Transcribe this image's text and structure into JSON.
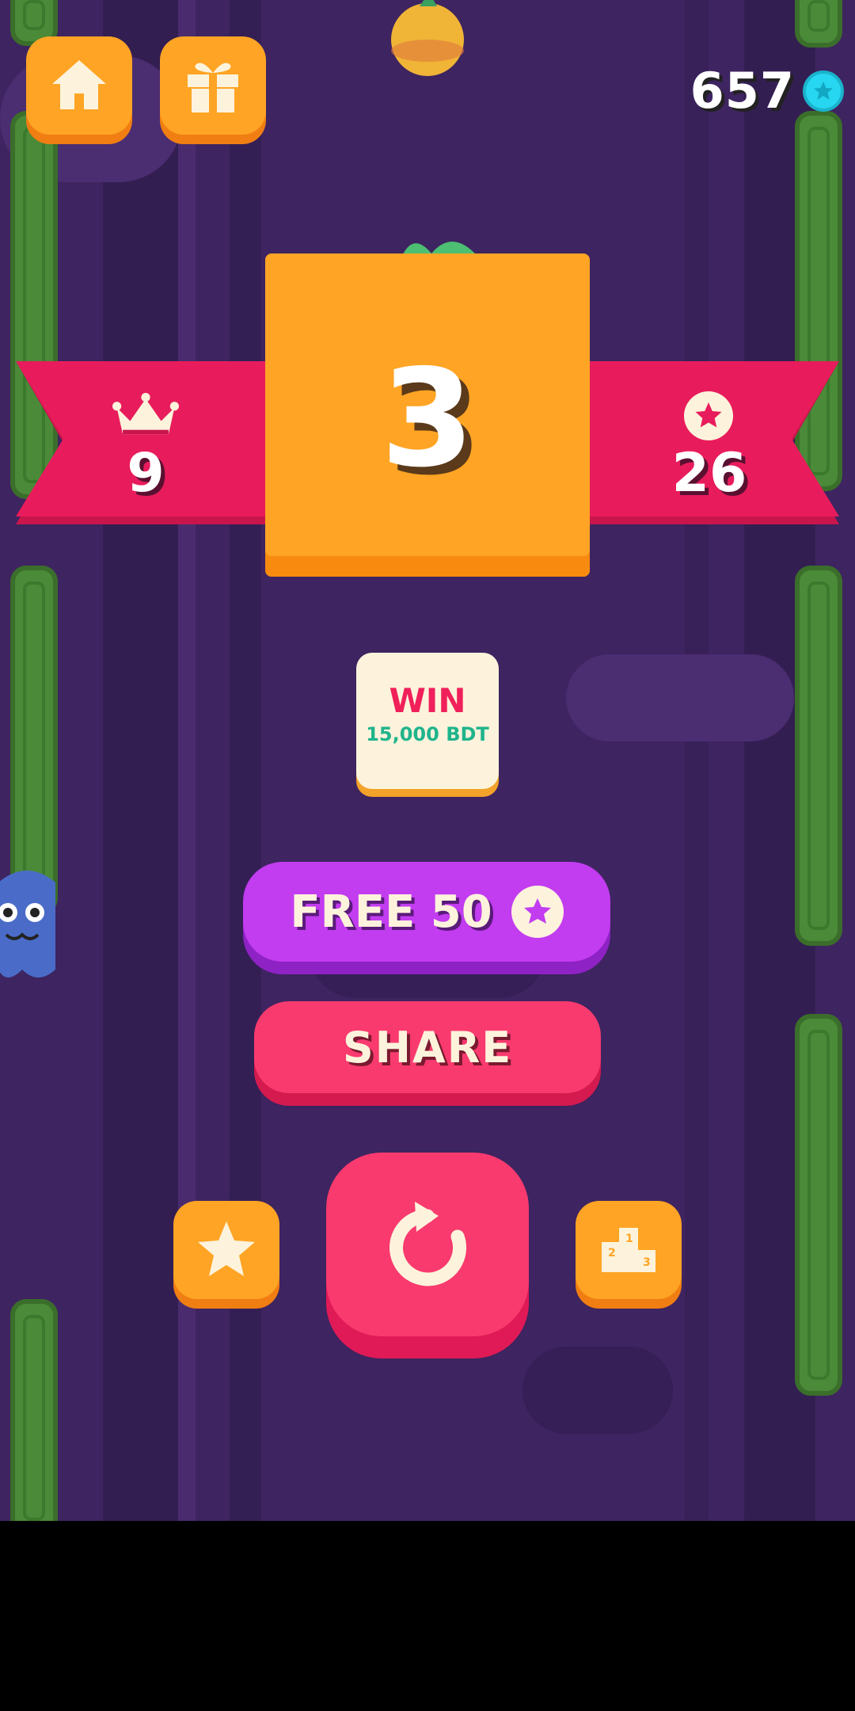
{
  "hud": {
    "coins": "657"
  },
  "stats": {
    "best": "9",
    "score": "3",
    "stars": "26"
  },
  "promo": {
    "title": "WIN",
    "subtitle": "15,000 BDT"
  },
  "buttons": {
    "free_label": "FREE 50",
    "share_label": "SHARE"
  },
  "icons": {
    "home": "home-icon",
    "gift": "gift-icon",
    "gem": "gem-icon",
    "crown": "crown-icon",
    "star": "star-icon",
    "replay": "replay-icon",
    "leaderboard": "podium-icon"
  },
  "colors": {
    "background": "#3e2460",
    "orange": "#ffa424",
    "ribbon": "#e81c5c",
    "pink": "#f93a6e",
    "purple": "#c23cf0",
    "cream": "#fdf3dc",
    "green": "#4a8a38"
  }
}
